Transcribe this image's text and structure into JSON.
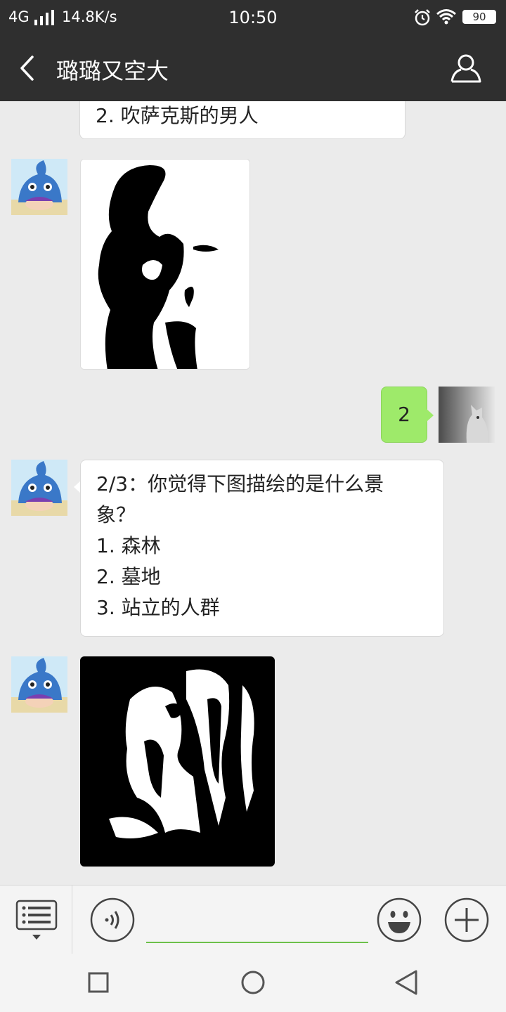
{
  "status_bar": {
    "network": "4G",
    "speed": "14.8K/s",
    "time": "10:50",
    "battery": "90"
  },
  "header": {
    "title": "璐璐又空大"
  },
  "messages": {
    "partial_text": "2. 吹萨克斯的男人",
    "my_reply": "2",
    "question_lines": [
      "2/3：你觉得下图描绘的是什么景",
      "象？",
      "1. 森林",
      "2. 墓地",
      "3. 站立的人群"
    ]
  },
  "input": {
    "placeholder": ""
  },
  "colors": {
    "header_bg": "#2f2f2f",
    "chat_bg": "#ebebeb",
    "my_bubble": "#9eea6a",
    "input_underline": "#6cc04a"
  }
}
